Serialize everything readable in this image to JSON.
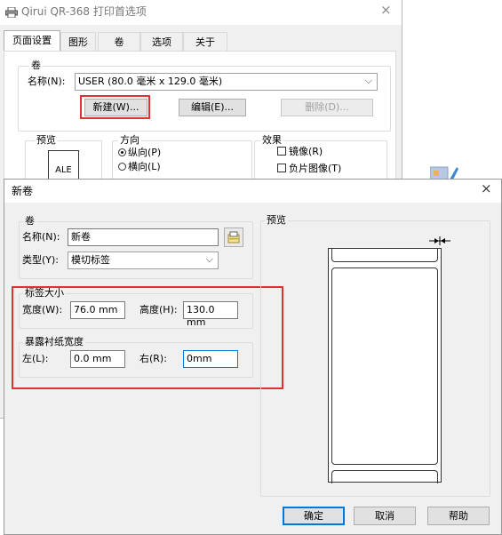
{
  "back_dialog": {
    "title": "Qirui QR-368 打印首选项",
    "tabs": [
      "页面设置",
      "图形",
      "卷",
      "选项",
      "关于"
    ],
    "roll_group": "卷",
    "name_label": "名称(N):",
    "name_value": "USER (80.0 毫米 x 129.0 毫米)",
    "new_btn": "新建(W)...",
    "edit_btn": "编辑(E)...",
    "delete_btn": "删除(D)...",
    "preview_group": "预览",
    "preview_text": "ALE",
    "orientation_group": "方向",
    "portrait": "纵向(P)",
    "landscape": "横向(L)",
    "effects_group": "效果",
    "mirror": "镜像(R)",
    "negative": "负片图像(T)"
  },
  "new_roll": {
    "title": "新卷",
    "roll_group": "卷",
    "name_label": "名称(N):",
    "name_value": "新卷",
    "type_label": "类型(Y):",
    "type_value": "模切标签",
    "size_group": "标签大小",
    "width_label": "宽度(W):",
    "width_value": "76.0 mm",
    "height_label": "高度(H):",
    "height_value": "130.0 mm",
    "exposed_group": "暴露衬纸宽度",
    "left_label": "左(L):",
    "left_value": "0.0 mm",
    "right_label": "右(R):",
    "right_value": "0mm",
    "preview_group": "预览",
    "ok_btn": "确定",
    "cancel_btn": "取消",
    "help_btn": "帮助"
  },
  "colors": {
    "highlight_red": "#e03030",
    "dialog_bg": "#f0f0f0",
    "focus_blue": "#0078d7"
  }
}
